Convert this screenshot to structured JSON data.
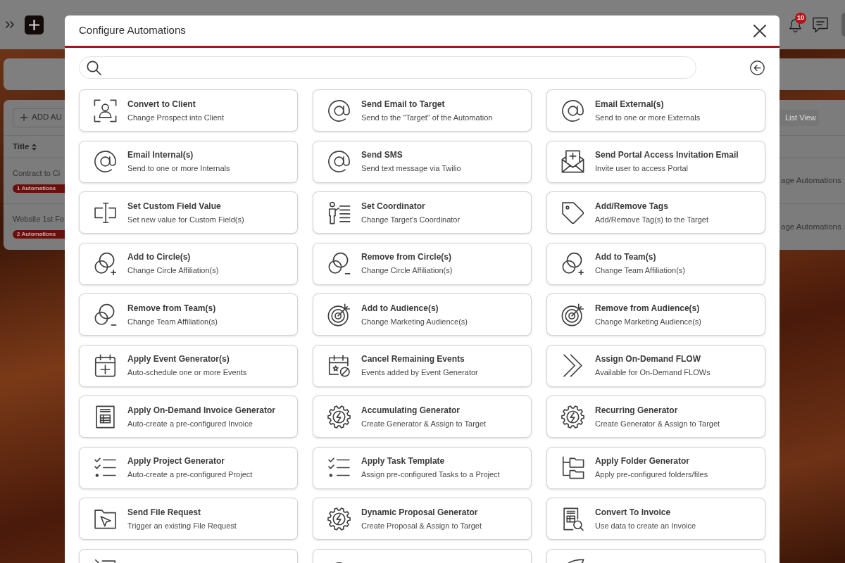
{
  "top_bar": {
    "notification_count": "10"
  },
  "page": {
    "add_button": "ADD AU",
    "view_button": "List View",
    "column": "Title",
    "rows": [
      {
        "title": "Contract to Ci",
        "badge": "1 Automations",
        "action": "age Automations"
      },
      {
        "title": "Website 1st Fo",
        "badge": "2 Automations",
        "action": "age Automations"
      }
    ]
  },
  "dialog": {
    "title": "Configure Automations",
    "cards": [
      {
        "kind": "convert",
        "title": "Convert to Client",
        "description": "Change Prospect into Client"
      },
      {
        "kind": "email",
        "title": "Send Email to Target",
        "description": "Send to the \"Target\" of the Automation"
      },
      {
        "kind": "email",
        "title": "Email External(s)",
        "description": "Send to one or more Externals"
      },
      {
        "kind": "email",
        "title": "Email Internal(s)",
        "description": "Send to one or more Internals"
      },
      {
        "kind": "email",
        "title": "Send SMS",
        "description": "Send text message via Twilio"
      },
      {
        "kind": "invite",
        "title": "Send Portal Access Invitation Email",
        "description": "Invite user to access Portal"
      },
      {
        "kind": "field",
        "title": "Set Custom Field Value",
        "description": "Set new value for Custom Field(s)"
      },
      {
        "kind": "coordinator",
        "title": "Set Coordinator",
        "description": "Change Target's Coordinator"
      },
      {
        "kind": "tag",
        "title": "Add/Remove Tags",
        "description": "Add/Remove Tag(s) to the Target"
      },
      {
        "kind": "join",
        "title": "Add to Circle(s)",
        "description": "Change Circle Affiliation(s)"
      },
      {
        "kind": "leave",
        "title": "Remove from Circle(s)",
        "description": "Change Circle Affiliation(s)"
      },
      {
        "kind": "join",
        "title": "Add to Team(s)",
        "description": "Change Team Affiliation(s)"
      },
      {
        "kind": "leave",
        "title": "Remove from Team(s)",
        "description": "Change Team Affiliation(s)"
      },
      {
        "kind": "audience",
        "title": "Add to Audience(s)",
        "description": "Change Marketing Audience(s)"
      },
      {
        "kind": "audience",
        "title": "Remove from Audience(s)",
        "description": "Change Marketing Audience(s)"
      },
      {
        "kind": "schedule",
        "title": "Apply Event Generator(s)",
        "description": "Auto-schedule one or more Events"
      },
      {
        "kind": "cancel",
        "title": "Cancel Remaining Events",
        "description": "Events added by Event Generator"
      },
      {
        "kind": "flow",
        "title": "Assign On-Demand FLOW",
        "description": "Available for On-Demand FLOWs"
      },
      {
        "kind": "invoice",
        "title": "Apply On-Demand Invoice Generator",
        "description": "Auto-create a pre-configured Invoice"
      },
      {
        "kind": "generator",
        "title": "Accumulating Generator",
        "description": "Create Generator & Assign to Target"
      },
      {
        "kind": "generator",
        "title": "Recurring Generator",
        "description": "Create Generator & Assign to Target"
      },
      {
        "kind": "checklist",
        "title": "Apply Project Generator",
        "description": "Auto-create a pre-configured Project"
      },
      {
        "kind": "checklist",
        "title": "Apply Task Template",
        "description": "Assign pre-configured Tasks to a Project"
      },
      {
        "kind": "folders",
        "title": "Apply Folder Generator",
        "description": "Apply pre-configured folders/files"
      },
      {
        "kind": "request",
        "title": "Send File Request",
        "description": "Trigger an existing File Request"
      },
      {
        "kind": "generator",
        "title": "Dynamic Proposal Generator",
        "description": "Create Proposal & Assign to Target"
      },
      {
        "kind": "lookup",
        "title": "Convert To Invoice",
        "description": "Use data to create an Invoice"
      },
      {
        "kind": "document"
      },
      {
        "kind": "stage"
      },
      {
        "kind": "deal"
      }
    ]
  }
}
